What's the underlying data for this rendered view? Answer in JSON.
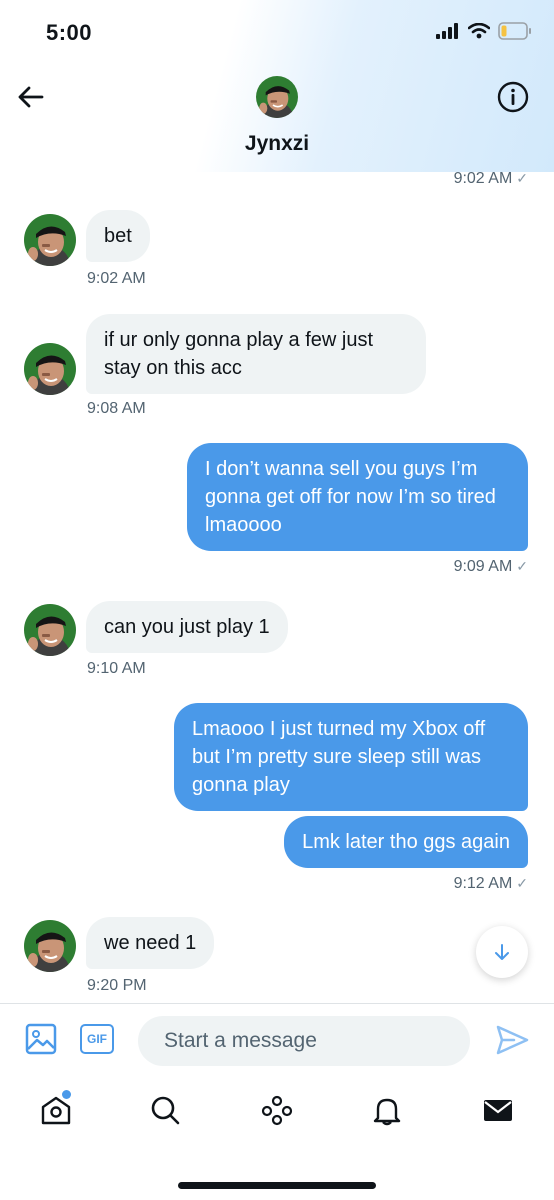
{
  "status_bar": {
    "time": "5:00"
  },
  "header": {
    "name": "Jynxzi"
  },
  "messages": [
    {
      "time": "9:02 AM",
      "check": "✓"
    },
    {
      "text": "bet",
      "time": "9:02 AM"
    },
    {
      "text": "if ur only gonna play a few just stay on this acc",
      "time": "9:08 AM"
    },
    {
      "text": "I don’t wanna sell you guys I’m gonna get off for now I’m so tired lmaoooo",
      "time": "9:09 AM",
      "check": "✓"
    },
    {
      "text": "can you just play 1",
      "time": "9:10 AM"
    },
    {
      "text": "Lmaooo I just turned my Xbox off but I’m pretty sure sleep still was gonna play"
    },
    {
      "text": "Lmk later tho ggs again",
      "time": "9:12 AM",
      "check": "✓"
    },
    {
      "text": "we need 1",
      "time": "9:20 PM"
    }
  ],
  "composer": {
    "gif_label": "GIF",
    "placeholder": "Start a message"
  },
  "icons": {
    "back": "arrow-left-icon",
    "info": "info-icon",
    "scroll": "arrow-down-icon",
    "image": "image-icon",
    "send": "send-icon",
    "tabs": [
      "home-icon",
      "search-icon",
      "spaces-icon",
      "bell-icon",
      "mail-icon"
    ]
  },
  "colors": {
    "accent": "#4a99e9",
    "bubble_in": "#eff3f4",
    "text_secondary": "#536471"
  }
}
